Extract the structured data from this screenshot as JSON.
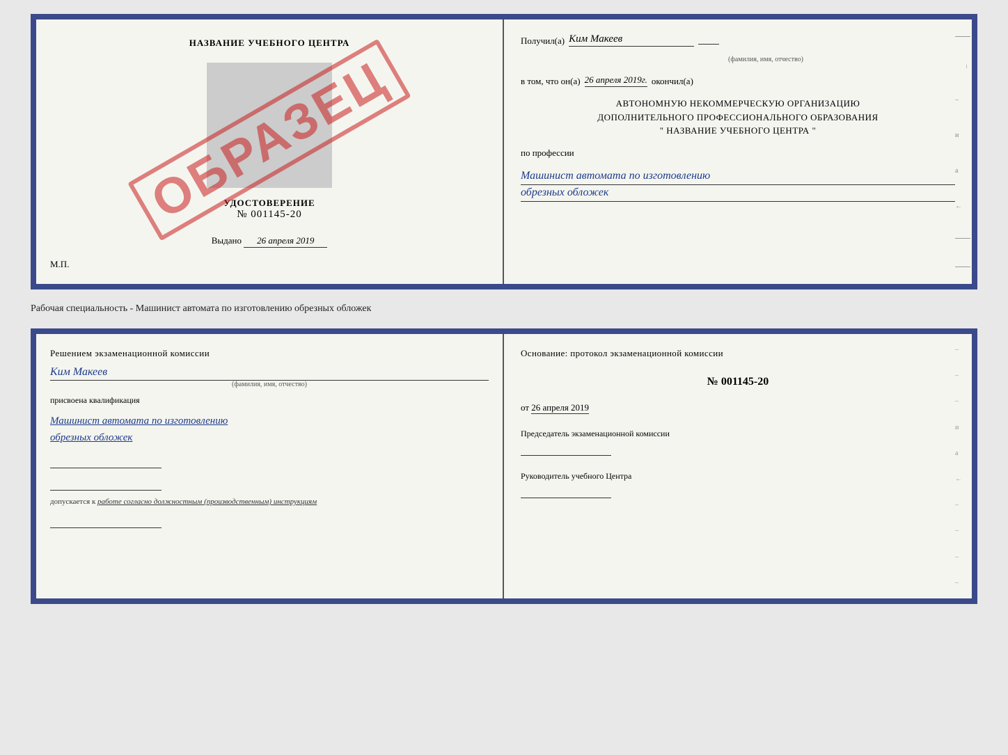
{
  "top_left": {
    "title": "НАЗВАНИЕ УЧЕБНОГО ЦЕНТРА",
    "udostoverenie_label": "УДОСТОВЕРЕНИЕ",
    "number": "№ 001145-20",
    "vidan_label": "Выдано",
    "vidan_date": "26 апреля 2019",
    "mp_label": "М.П.",
    "obrazec": "ОБРАЗЕЦ"
  },
  "top_right": {
    "poluchil_label": "Получил(a)",
    "recipient_name": "Ким Макеев",
    "fio_hint": "(фамилия, имя, отчество)",
    "vtom_label": "в том, что он(а)",
    "date_val": "26 апреля 2019г.",
    "okonchil_label": "окончил(а)",
    "org_line1": "АВТОНОМНУЮ НЕКОММЕРЧЕСКУЮ ОРГАНИЗАЦИЮ",
    "org_line2": "ДОПОЛНИТЕЛЬНОГО ПРОФЕССИОНАЛЬНОГО ОБРАЗОВАНИЯ",
    "org_name": "\"   НАЗВАНИЕ УЧЕБНОГО ЦЕНТРА   \"",
    "po_professii_label": "по профессии",
    "professiya_line1": "Машинист автомата по изготовлению",
    "professiya_line2": "обрезных обложек"
  },
  "separator": {
    "text": "Рабочая специальность - Машинист автомата по изготовлению обрезных обложек"
  },
  "bottom_left": {
    "resheniem_label": "Решением экзаменационной комиссии",
    "name": "Ким Макеев",
    "fio_hint": "(фамилия, имя, отчество)",
    "prisvoena_label": "присвоена квалификация",
    "kvalif_line1": "Машинист автомата по изготовлению",
    "kvalif_line2": "обрезных обложек",
    "dopuskaetsya_label": "допускается к",
    "dopuskaetsya_val": "работе согласно должностным (производственным) инструкциям"
  },
  "bottom_right": {
    "osnovanie_label": "Основание: протокол экзаменационной комиссии",
    "protocol_number": "№ 001145-20",
    "ot_label": "от",
    "ot_date": "26 апреля 2019",
    "predsedatel_label": "Председатель экзаменационной комиссии",
    "rukovoditel_label": "Руководитель учебного Центра"
  },
  "spine_items": [
    "–",
    "–",
    "–",
    "–",
    "и",
    "а",
    "←",
    "–",
    "–",
    "–",
    "–"
  ]
}
